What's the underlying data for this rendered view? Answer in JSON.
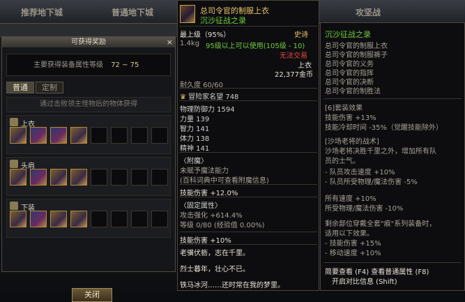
{
  "topnav": {
    "tabs": [
      "推荐地下城",
      "普通地下城",
      "",
      "攻坚战"
    ]
  },
  "reward": {
    "title": "可获得奖励",
    "close_x": "×",
    "level_label": "主要获得装备属性等级",
    "level_range": "72 ~ 75",
    "tab_normal": "普通",
    "tab_custom": "定制",
    "hint": "通过击败领主怪物后的物体获得",
    "categories": [
      {
        "name": "上衣"
      },
      {
        "name": "头肩"
      },
      {
        "name": "下装"
      }
    ],
    "close_button": "关闭"
  },
  "tooltip": {
    "name": "总司令官的制服上衣",
    "set": "沉沙征战之录",
    "max_level": "最上级（95%）",
    "rarity": "史诗",
    "weight": "1.4kg",
    "req": "95级以上可以使用(105级 - 10)",
    "trade": "无法交易",
    "slot": "上衣",
    "price": "22,377金币",
    "durability": "耐久度 60/60",
    "fame": "冒险家名望 748",
    "phys_def": "物理防御力 1594",
    "str": "力量 139",
    "int": "智力 141",
    "vit": "体力 138",
    "spr": "精神 141",
    "enchant_title": "〈附魔〉",
    "enchant_none": "未赋予魔法能力",
    "enchant_hint": "(百科词典中可查看附魔信息)",
    "skill_dmg_label": "技能伤害",
    "skill_dmg_val": "+12.0%",
    "fixed_title": "〈固定属性〉",
    "atk_enh": "攻击强化 +614.4%",
    "grade": "等级 0/80 (经验值 0.00%)",
    "skill_dmg2": "技能伤害 +10%",
    "flavor": [
      "老骥伏枥，志在千里。",
      "烈士暮年，壮心不已。",
      "铁马冰河……还时常在我的梦里。"
    ]
  },
  "setinfo": {
    "title": "沉沙征战之录",
    "parts": [
      "总司令官的制服上衣",
      "总司令官的制服裤子",
      "总司令官的义务",
      "总司令官的指挥",
      "总司令官的决断",
      "总司令官的制胜法"
    ],
    "effect_title": "[6]套装效果",
    "effects": [
      "技能伤害 +13%",
      "技能冷却时间 -35%（觉醒技能除外）"
    ],
    "tactic_title": "[沙场老将的战术]",
    "tactic_desc": [
      "沙场老将决胜千里之外，增加所有队",
      "员的士气。"
    ],
    "party": [
      "- 队员攻击速度 +10%",
      "- 队员所受物理/魔法伤害 -5%"
    ],
    "global": [
      "所有速度 +10%",
      "所受物理/魔法伤害 -10%"
    ],
    "rest": [
      "剩余部位穿戴全套\"痕\"系列装备时，",
      "适用以下效果。",
      "- 技能伤害 +15%",
      "- 移动速度 +10%"
    ],
    "footer": [
      "简要查看 (F4) 查看普通属性 (F8)",
      "开启对比信息 (Shift)"
    ]
  }
}
